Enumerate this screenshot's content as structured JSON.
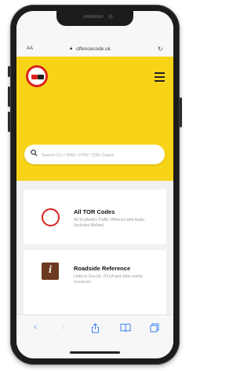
{
  "browser": {
    "aa_label": "AA",
    "url": "offencecode.uk",
    "lock_icon": "lock-icon",
    "reload_icon": "reload-icon"
  },
  "header": {
    "background": "#f7d417",
    "logo_icon": "no-overtaking-sign-icon",
    "menu_icon": "hamburger-menu-icon"
  },
  "search": {
    "placeholder": "Search CU / RND / FPN / TOR Codes"
  },
  "cards": [
    {
      "title": "All TOR Codes",
      "description": "All Scotland's Traffic Offences with Audio (includes Mellow)",
      "icon": "red-circle-icon"
    },
    {
      "title": "Roadside Reference",
      "description": "Links to Gov.Uk, DVLA and other useful resources",
      "icon": "info-icon"
    }
  ],
  "toolbar": {
    "back_icon": "chevron-left-icon",
    "forward_icon": "chevron-right-icon",
    "share_icon": "share-icon",
    "bookmarks_icon": "book-icon",
    "tabs_icon": "tabs-icon"
  },
  "colors": {
    "accent_red": "#d9241c",
    "ios_blue": "#3b82f6",
    "info_brown": "#6b3a1f"
  }
}
